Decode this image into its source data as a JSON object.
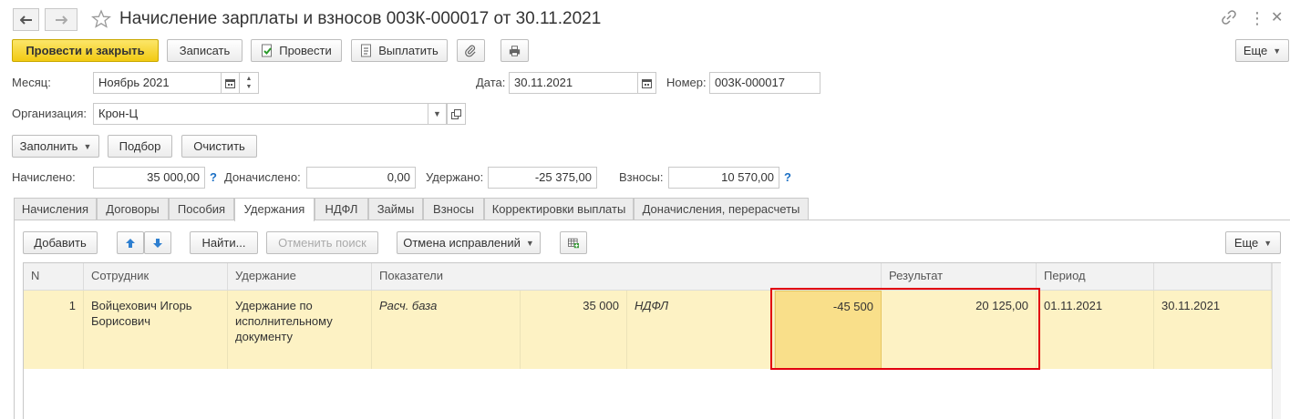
{
  "window": {
    "title": "Начисление зарплаты и взносов 003К-000017 от 30.11.2021"
  },
  "toolbar": {
    "post_close": "Провести и закрыть",
    "save": "Записать",
    "post": "Провести",
    "pay": "Выплатить",
    "more": "Еще"
  },
  "header": {
    "month_label": "Месяц:",
    "month_value": "Ноябрь 2021",
    "date_label": "Дата:",
    "date_value": "30.11.2021",
    "number_label": "Номер:",
    "number_value": "003К-000017",
    "org_label": "Организация:",
    "org_value": "Крон-Ц"
  },
  "actions": {
    "fill": "Заполнить",
    "pick": "Подбор",
    "clear": "Очистить"
  },
  "totals": {
    "accrued_label": "Начислено:",
    "accrued_value": "35 000,00",
    "extra_label": "Доначислено:",
    "extra_value": "0,00",
    "withheld_label": "Удержано:",
    "withheld_value": "-25 375,00",
    "contrib_label": "Взносы:",
    "contrib_value": "10 570,00",
    "help": "?"
  },
  "tabs": [
    {
      "label": "Начисления"
    },
    {
      "label": "Договоры"
    },
    {
      "label": "Пособия"
    },
    {
      "label": "Удержания"
    },
    {
      "label": "НДФЛ"
    },
    {
      "label": "Займы"
    },
    {
      "label": "Взносы"
    },
    {
      "label": "Корректировки выплаты"
    },
    {
      "label": "Доначисления, перерасчеты"
    }
  ],
  "grid_toolbar": {
    "add": "Добавить",
    "find": "Найти...",
    "cancel_search": "Отменить поиск",
    "cancel_fixes": "Отмена исправлений",
    "more": "Еще"
  },
  "table": {
    "columns": {
      "n": "N",
      "employee": "Сотрудник",
      "deduction": "Удержание",
      "indicators": "Показатели",
      "result": "Результат",
      "period": "Период"
    },
    "rows": [
      {
        "n": "1",
        "employee": "Войцехович Игорь Борисович",
        "deduction": "Удержание по исполнительному документу",
        "ind1_name": "Расч. база",
        "ind1_value": "35 000",
        "ind2_name": "НДФЛ",
        "ind2_value": "-45 500",
        "result": "20 125,00",
        "period_from": "01.11.2021",
        "period_to": "30.11.2021"
      }
    ]
  },
  "colors": {
    "primary": "#f5cf1c",
    "row_selected": "#fdf2c4",
    "cell_selected": "#f9df8a",
    "highlight": "#e2000f",
    "help": "#1a6fc4"
  }
}
